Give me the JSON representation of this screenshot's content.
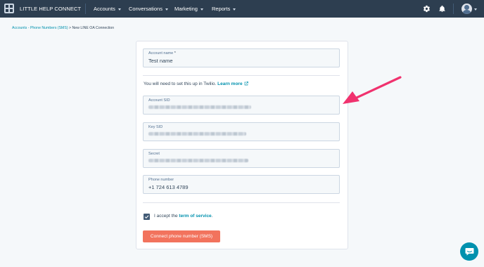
{
  "topbar": {
    "brand": "LITTLE HELP CONNECT",
    "nav": [
      {
        "label": "Accounts"
      },
      {
        "label": "Conversations"
      },
      {
        "label": "Marketing"
      },
      {
        "label": "Reports"
      }
    ],
    "icons": [
      "settings-gear-icon",
      "notifications-bell-icon",
      "user-avatar"
    ],
    "bg_color": "#2d3e50"
  },
  "breadcrumb": {
    "link": "Accounts - Phone Numbers (SMS)",
    "separator": " > ",
    "current": "New LINE OA Connection"
  },
  "form": {
    "account_name": {
      "label": "Account name",
      "required_mark": "*",
      "value": "Test name"
    },
    "twilio_note": {
      "text": "You will need to set this up in Twilio.",
      "link": "Learn more",
      "link_icon": "external-link-icon"
    },
    "account_sid": {
      "label": "Account SID",
      "value_state": "redacted"
    },
    "key_sid": {
      "label": "Key SID",
      "value_state": "redacted"
    },
    "secret": {
      "label": "Secret",
      "value_state": "redacted"
    },
    "phone_number": {
      "label": "Phone number",
      "value": "+1 724 613 4789"
    },
    "terms": {
      "checked": true,
      "prefix": "I accept the",
      "link": "term of service",
      "suffix": "."
    },
    "submit_label": "Connect phone number (SMS)"
  },
  "colors": {
    "accent": "#0091ae",
    "primary_button": "#f2735d",
    "annotation_arrow": "#f0326e"
  },
  "chat_widget": {
    "icon": "chat-bubble-icon"
  }
}
